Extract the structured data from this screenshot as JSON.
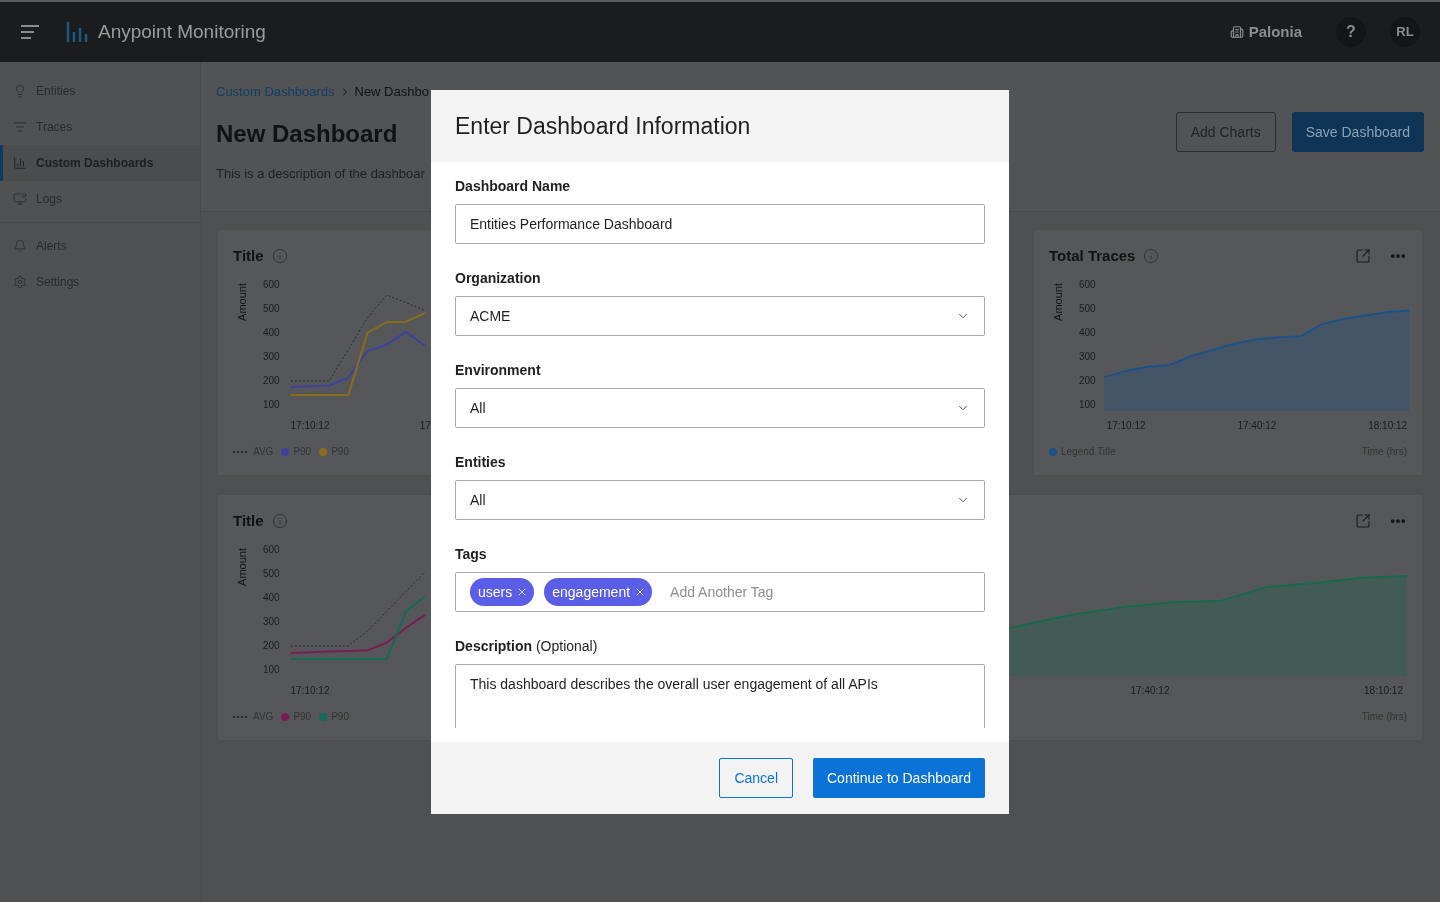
{
  "topbar": {
    "app_name": "Anypoint Monitoring",
    "org": "Palonia",
    "help": "?",
    "avatar": "RL"
  },
  "sidebar": {
    "groups": [
      [
        {
          "label": "Entities",
          "selected": false
        },
        {
          "label": "Traces",
          "selected": false
        },
        {
          "label": "Custom Dashboards",
          "selected": true
        },
        {
          "label": "Logs",
          "selected": false
        }
      ],
      [
        {
          "label": "Alerts",
          "selected": false
        },
        {
          "label": "Settings",
          "selected": false
        }
      ]
    ]
  },
  "breadcrumb": [
    "Custom Dashboards",
    "New Dashbo"
  ],
  "page": {
    "title": "New Dashboard",
    "description": "This is a description of the dashboar",
    "buttons": [
      {
        "label": "Add Charts",
        "kind": "secondary"
      },
      {
        "label": "Save Dashboard",
        "kind": "primary"
      }
    ]
  },
  "cards": [
    {
      "title": "Title",
      "info": true,
      "actions": false,
      "wide": false,
      "chart_data": {
        "type": "line",
        "ylabel": "Amount",
        "categories": [
          null,
          "17:10:12",
          null,
          null,
          null,
          null,
          null,
          "17"
        ],
        "ylim": [
          100,
          600
        ],
        "yticks": [
          100,
          200,
          300,
          400,
          500,
          600
        ],
        "series": [
          {
            "name": "AVG",
            "color": "#2b2b2b",
            "line_style": "dashed",
            "values": [
              196,
              196,
              196,
              327,
              460,
              554,
              522,
              490
            ]
          },
          {
            "name": "P90",
            "color": "#3e41a0",
            "line_style": "solid",
            "values": [
              171,
              174,
              177,
              210,
              321,
              347,
              400,
              343
            ]
          },
          {
            "name": "P90",
            "color": "#8a6d1c",
            "line_style": "solid",
            "values": [
              138,
              138,
              138,
              138,
              397,
              441,
              443,
              480
            ]
          }
        ]
      }
    },
    {
      "title": "Total Traces",
      "info": true,
      "actions": true,
      "wide": false,
      "chart_data": {
        "type": "area",
        "ylabel": "Amount",
        "xlabel": "Time (hrs)",
        "categories": [
          null,
          "17:10:12",
          null,
          null,
          null,
          null,
          null,
          "17:40:12",
          null,
          null,
          null,
          null,
          null,
          "18:10:12",
          null
        ],
        "ylim": [
          100,
          600
        ],
        "yticks": [
          100,
          200,
          300,
          400,
          500,
          600
        ],
        "series": [
          {
            "name": "Legend Title",
            "color": "#1c5288",
            "line_style": "solid",
            "values": [
              212,
              238,
              255,
              263,
              300,
              326,
              352,
              370,
              378,
              382,
              433,
              455,
              469,
              483,
              490
            ]
          }
        ]
      }
    },
    {
      "title": "Title",
      "info": true,
      "actions": false,
      "wide": false,
      "chart_data": {
        "type": "line",
        "ylabel": "Amount",
        "categories": [
          null,
          "17:10:12",
          null,
          null,
          null,
          null,
          null,
          null
        ],
        "ylim": [
          100,
          600
        ],
        "yticks": [
          100,
          200,
          300,
          400,
          500,
          600
        ],
        "series": [
          {
            "name": "AVG",
            "color": "#2b2b2b",
            "line_style": "dashed",
            "values": [
              196,
              196,
              196,
              196,
              259,
              341,
              423,
              505
            ]
          },
          {
            "name": "P90",
            "color": "#7a1d55",
            "line_style": "solid",
            "values": [
              167,
              170,
              173,
              175,
              178,
              210,
              272,
              326
            ]
          },
          {
            "name": "P90",
            "color": "#156a58",
            "line_style": "solid",
            "values": [
              142,
              142,
              142,
              142,
              142,
              142,
              341,
              403
            ]
          }
        ]
      }
    },
    {
      "actions": true,
      "wide": true,
      "x_labels": [
        "17:40:12",
        "18:10:12"
      ],
      "xlabel": "Time (hrs)"
    }
  ],
  "modal": {
    "title": "Enter Dashboard Information",
    "fields": [
      {
        "kind": "text",
        "label": "Dashboard Name",
        "value": "Entities Performance Dashboard"
      },
      {
        "kind": "select",
        "label": "Organization",
        "value": "ACME"
      },
      {
        "kind": "select",
        "label": "Environment",
        "value": "All"
      },
      {
        "kind": "select",
        "label": "Entities",
        "value": "All"
      },
      {
        "kind": "tags",
        "label": "Tags",
        "tags": [
          "users",
          "engagement"
        ],
        "placeholder": "Add Another Tag"
      },
      {
        "kind": "textarea",
        "label": "Description",
        "note": "(Optional)",
        "value": "This dashboard describes the overall user engagement of all APIs"
      }
    ],
    "buttons": [
      {
        "label": "Cancel",
        "kind": "secondary"
      },
      {
        "label": "Continue to Dashboard",
        "kind": "primary"
      }
    ]
  }
}
